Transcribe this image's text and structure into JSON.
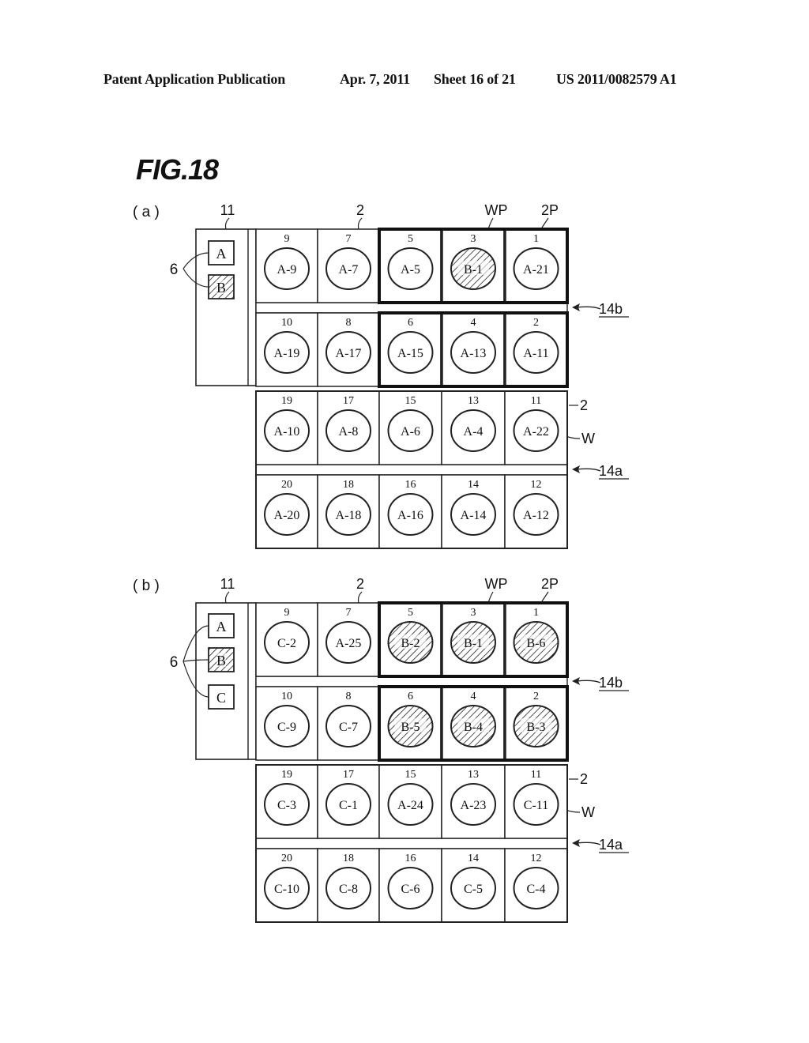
{
  "header": {
    "publication": "Patent Application Publication",
    "date": "Apr. 7, 2011",
    "sheet": "Sheet 16 of 21",
    "number": "US 2011/0082579 A1"
  },
  "figure": {
    "title": "FIG.18",
    "panels": [
      {
        "id": "a",
        "label": "( a )",
        "stocker_label": "11",
        "carrier_label": "2",
        "wp_label": "WP",
        "priority_label": "2P",
        "aisle_upper_label": "14b",
        "aisle_lower_label": "14a",
        "wafer_label": "W",
        "port_group_label": "6",
        "ports": [
          {
            "name": "A",
            "hatched": false
          },
          {
            "name": "B",
            "hatched": true
          }
        ],
        "rows": [
          [
            {
              "slot": "9",
              "wafer": "A-9",
              "hatched": false,
              "priority": false
            },
            {
              "slot": "7",
              "wafer": "A-7",
              "hatched": false,
              "priority": false
            },
            {
              "slot": "5",
              "wafer": "A-5",
              "hatched": false,
              "priority": true
            },
            {
              "slot": "3",
              "wafer": "B-1",
              "hatched": true,
              "priority": true
            },
            {
              "slot": "1",
              "wafer": "A-21",
              "hatched": false,
              "priority": true
            }
          ],
          [
            {
              "slot": "10",
              "wafer": "A-19",
              "hatched": false,
              "priority": false
            },
            {
              "slot": "8",
              "wafer": "A-17",
              "hatched": false,
              "priority": false
            },
            {
              "slot": "6",
              "wafer": "A-15",
              "hatched": false,
              "priority": true
            },
            {
              "slot": "4",
              "wafer": "A-13",
              "hatched": false,
              "priority": true
            },
            {
              "slot": "2",
              "wafer": "A-11",
              "hatched": false,
              "priority": true
            }
          ],
          [
            {
              "slot": "19",
              "wafer": "A-10",
              "hatched": false,
              "priority": false
            },
            {
              "slot": "17",
              "wafer": "A-8",
              "hatched": false,
              "priority": false
            },
            {
              "slot": "15",
              "wafer": "A-6",
              "hatched": false,
              "priority": false
            },
            {
              "slot": "13",
              "wafer": "A-4",
              "hatched": false,
              "priority": false
            },
            {
              "slot": "11",
              "wafer": "A-22",
              "hatched": false,
              "priority": false
            }
          ],
          [
            {
              "slot": "20",
              "wafer": "A-20",
              "hatched": false,
              "priority": false
            },
            {
              "slot": "18",
              "wafer": "A-18",
              "hatched": false,
              "priority": false
            },
            {
              "slot": "16",
              "wafer": "A-16",
              "hatched": false,
              "priority": false
            },
            {
              "slot": "14",
              "wafer": "A-14",
              "hatched": false,
              "priority": false
            },
            {
              "slot": "12",
              "wafer": "A-12",
              "hatched": false,
              "priority": false
            }
          ]
        ]
      },
      {
        "id": "b",
        "label": "( b )",
        "stocker_label": "11",
        "carrier_label": "2",
        "wp_label": "WP",
        "priority_label": "2P",
        "aisle_upper_label": "14b",
        "aisle_lower_label": "14a",
        "wafer_label": "W",
        "port_group_label": "6",
        "ports": [
          {
            "name": "A",
            "hatched": false
          },
          {
            "name": "B",
            "hatched": true
          },
          {
            "name": "C",
            "hatched": false
          }
        ],
        "rows": [
          [
            {
              "slot": "9",
              "wafer": "C-2",
              "hatched": false,
              "priority": false
            },
            {
              "slot": "7",
              "wafer": "A-25",
              "hatched": false,
              "priority": false
            },
            {
              "slot": "5",
              "wafer": "B-2",
              "hatched": true,
              "priority": true
            },
            {
              "slot": "3",
              "wafer": "B-1",
              "hatched": true,
              "priority": true
            },
            {
              "slot": "1",
              "wafer": "B-6",
              "hatched": true,
              "priority": true
            }
          ],
          [
            {
              "slot": "10",
              "wafer": "C-9",
              "hatched": false,
              "priority": false
            },
            {
              "slot": "8",
              "wafer": "C-7",
              "hatched": false,
              "priority": false
            },
            {
              "slot": "6",
              "wafer": "B-5",
              "hatched": true,
              "priority": true
            },
            {
              "slot": "4",
              "wafer": "B-4",
              "hatched": true,
              "priority": true
            },
            {
              "slot": "2",
              "wafer": "B-3",
              "hatched": true,
              "priority": true
            }
          ],
          [
            {
              "slot": "19",
              "wafer": "C-3",
              "hatched": false,
              "priority": false
            },
            {
              "slot": "17",
              "wafer": "C-1",
              "hatched": false,
              "priority": false
            },
            {
              "slot": "15",
              "wafer": "A-24",
              "hatched": false,
              "priority": false
            },
            {
              "slot": "13",
              "wafer": "A-23",
              "hatched": false,
              "priority": false
            },
            {
              "slot": "11",
              "wafer": "C-11",
              "hatched": false,
              "priority": false
            }
          ],
          [
            {
              "slot": "20",
              "wafer": "C-10",
              "hatched": false,
              "priority": false
            },
            {
              "slot": "18",
              "wafer": "C-8",
              "hatched": false,
              "priority": false
            },
            {
              "slot": "16",
              "wafer": "C-6",
              "hatched": false,
              "priority": false
            },
            {
              "slot": "14",
              "wafer": "C-5",
              "hatched": false,
              "priority": false
            },
            {
              "slot": "12",
              "wafer": "C-4",
              "hatched": false,
              "priority": false
            }
          ]
        ]
      }
    ]
  }
}
